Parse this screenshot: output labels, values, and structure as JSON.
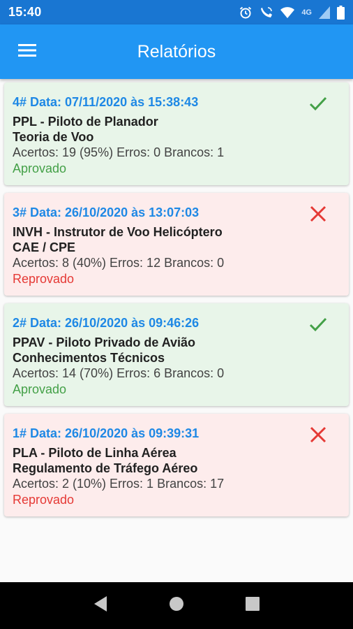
{
  "status_bar": {
    "time": "15:40",
    "network_label": "4G"
  },
  "app_bar": {
    "title": "Relatórios"
  },
  "colors": {
    "primary": "#2196f3",
    "status_bar": "#1976d2",
    "approved_bg": "#e8f5e9",
    "failed_bg": "#fdecec",
    "approved": "#43a047",
    "failed": "#e53935",
    "date": "#1e88e5"
  },
  "reports": [
    {
      "date": "4# Data: 07/11/2020 às 15:38:43",
      "course": "PPL - Piloto de Planador",
      "subject": "Teoria de Voo",
      "stats": "Acertos: 19 (95%) Erros: 0  Brancos: 1",
      "result": "Aprovado",
      "status": "approved",
      "icon": "check-icon"
    },
    {
      "date": "3# Data: 26/10/2020 às 13:07:03",
      "course": "INVH - Instrutor de Voo Helicóptero",
      "subject": "CAE / CPE",
      "stats": "Acertos: 8 (40%) Erros: 12  Brancos: 0",
      "result": "Reprovado",
      "status": "failed",
      "icon": "close-icon"
    },
    {
      "date": "2# Data: 26/10/2020 às 09:46:26",
      "course": "PPAV - Piloto Privado de Avião",
      "subject": "Conhecimentos Técnicos",
      "stats": "Acertos: 14 (70%) Erros: 6  Brancos: 0",
      "result": "Aprovado",
      "status": "approved",
      "icon": "check-icon"
    },
    {
      "date": "1# Data: 26/10/2020 às 09:39:31",
      "course": "PLA - Piloto de Linha Aérea",
      "subject": "Regulamento de Tráfego Aéreo",
      "stats": "Acertos: 2 (10%) Erros: 1  Brancos: 17",
      "result": "Reprovado",
      "status": "failed",
      "icon": "close-icon"
    }
  ]
}
